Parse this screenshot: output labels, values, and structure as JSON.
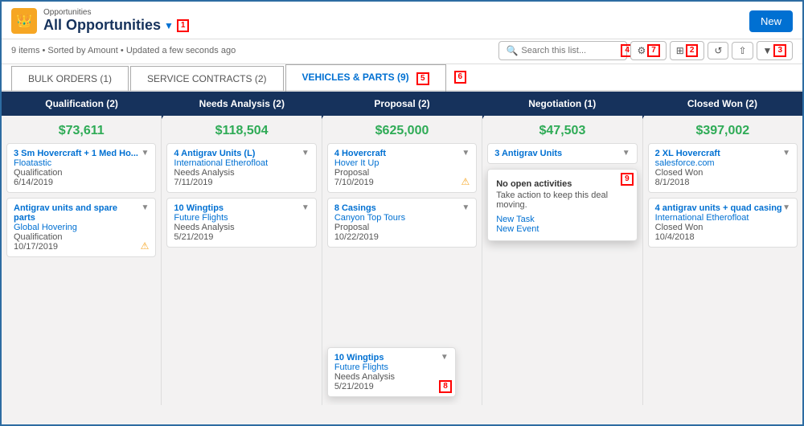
{
  "page": {
    "border_color": "#2d6ca2"
  },
  "header": {
    "icon": "👑",
    "subtitle": "Opportunities",
    "title": "All Opportunities",
    "dropdown_label": "▼",
    "annotation_1": "1",
    "new_button": "New",
    "status_text": "9 items • Sorted by Amount • Updated a few seconds ago"
  },
  "search": {
    "placeholder": "Search this list...",
    "annotation_4": "4"
  },
  "toolbar": {
    "gear_icon": "⚙",
    "grid_icon": "⊞",
    "refresh_icon": "↺",
    "share_icon": "⇧",
    "filter_icon": "▼",
    "annotation_2": "2",
    "annotation_3": "3",
    "annotation_7": "7"
  },
  "tabs": [
    {
      "label": "BULK ORDERS (1)",
      "active": false
    },
    {
      "label": "SERVICE CONTRACTS (2)",
      "active": false
    },
    {
      "label": "VEHICLES & PARTS (9)",
      "active": true
    }
  ],
  "tab_annotations": {
    "annotation_5": "5",
    "annotation_6": "6"
  },
  "kanban": {
    "columns": [
      {
        "id": "qualification",
        "label": "Qualification (2)",
        "total": "$73,611",
        "cards": [
          {
            "title": "3 Sm Hovercraft + 1 Med Ho...",
            "company": "Floatastic",
            "stage": "Qualification",
            "date": "6/14/2019",
            "warning": false
          },
          {
            "title": "Antigrav units and spare parts",
            "company": "Global Hovering",
            "stage": "Qualification",
            "date": "10/17/2019",
            "warning": true
          }
        ]
      },
      {
        "id": "needs-analysis",
        "label": "Needs Analysis (2)",
        "total": "$118,504",
        "cards": [
          {
            "title": "4 Antigrav Units (L)",
            "company": "International Etherofloat",
            "stage": "Needs Analysis",
            "date": "7/11/2019",
            "warning": false
          },
          {
            "title": "10 Wingtips",
            "company": "Future Flights",
            "stage": "Needs Analysis",
            "date": "5/21/2019",
            "warning": false
          }
        ]
      },
      {
        "id": "proposal",
        "label": "Proposal (2)",
        "total": "$625,000",
        "cards": [
          {
            "title": "4 Hovercraft",
            "company": "Hover It Up",
            "stage": "Proposal",
            "date": "7/10/2019",
            "warning": true
          },
          {
            "title": "8 Casings",
            "company": "Canyon Top Tours",
            "stage": "Proposal",
            "date": "10/22/2019",
            "warning": false
          }
        ],
        "dragged_card": {
          "title": "10 Wingtips",
          "company": "Future Flights",
          "stage": "Needs Analysis",
          "date": "5/21/2019",
          "annotation_8": "8"
        }
      },
      {
        "id": "negotiation",
        "label": "Negotiation (1)",
        "total": "$47,503",
        "cards": [
          {
            "title": "3 Antigrav Units",
            "company": "",
            "stage": "",
            "date": "",
            "popup": true
          }
        ],
        "popup": {
          "no_activity": "No open activities",
          "message": "Take action to keep this deal moving.",
          "links": [
            "New Task",
            "New Event"
          ],
          "annotation_9": "9"
        }
      },
      {
        "id": "closed-won",
        "label": "Closed Won (2)",
        "total": "$397,002",
        "cards": [
          {
            "title": "2 XL Hovercraft",
            "company": "salesforce.com",
            "stage": "Closed Won",
            "date": "8/1/2018",
            "warning": false
          },
          {
            "title": "4 antigrav units + quad casing",
            "company": "International Etherofloat",
            "stage": "Closed Won",
            "date": "10/4/2018",
            "warning": false
          }
        ]
      }
    ]
  }
}
